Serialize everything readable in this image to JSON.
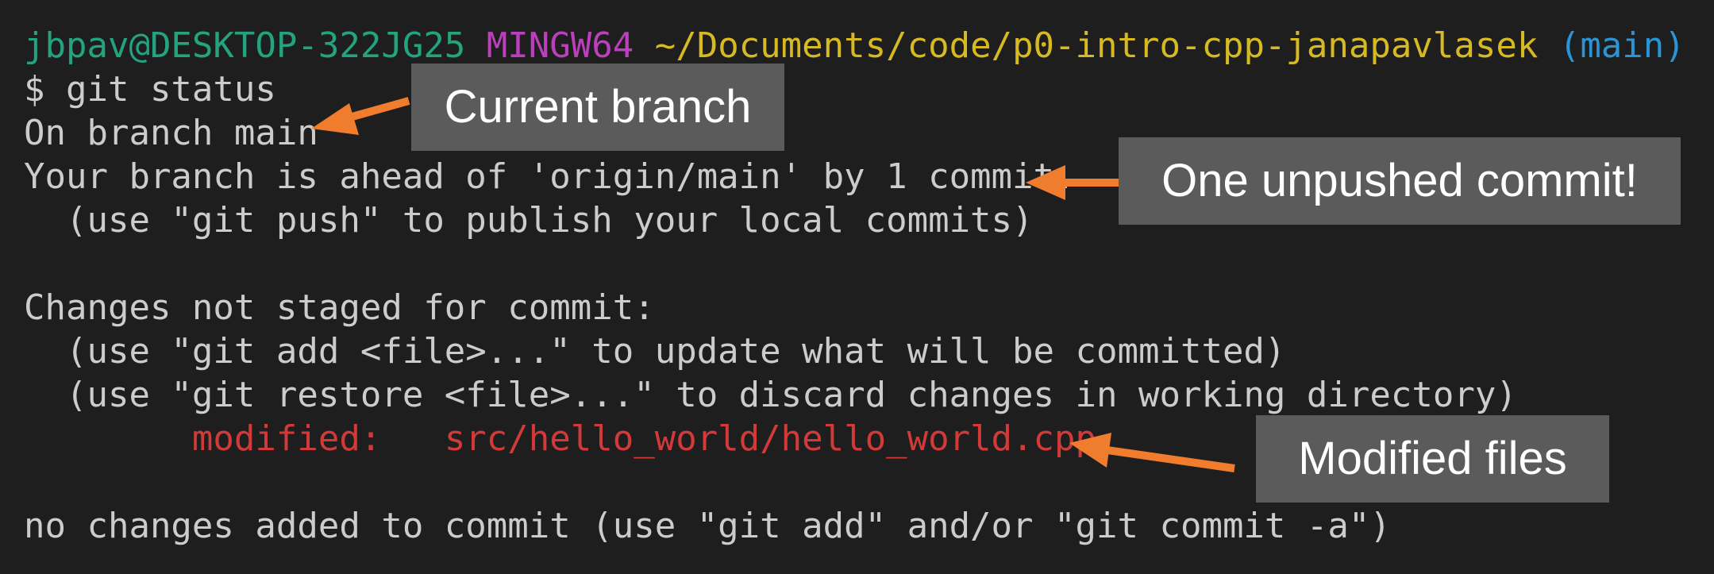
{
  "prompt": {
    "user_host": "jbpav@DESKTOP-322JG25",
    "env": "MINGW64",
    "path": "~/Documents/code/p0-intro-cpp-janapavlasek",
    "branch": "(main)"
  },
  "command": "$ git status",
  "output": {
    "line1": "On branch main",
    "line2": "Your branch is ahead of 'origin/main' by 1 commit.",
    "line3": "  (use \"git push\" to publish your local commits)",
    "line4": "Changes not staged for commit:",
    "line5": "  (use \"git add <file>...\" to update what will be committed)",
    "line6": "  (use \"git restore <file>...\" to discard changes in working directory)",
    "modified_label": "        modified:   ",
    "modified_file": "src/hello_world/hello_world.cpp",
    "line8": "no changes added to commit (use \"git add\" and/or \"git commit -a\")"
  },
  "callouts": {
    "current_branch": "Current branch",
    "unpushed": "One unpushed commit!",
    "modified_files": "Modified files"
  },
  "colors": {
    "background": "#1e1e1e",
    "text": "#cccccc",
    "user": "#23a47f",
    "env": "#bc3fbc",
    "path": "#d7ba22",
    "branch": "#2995d6",
    "modified": "#d23a3a",
    "callout_bg": "#5b5b5b",
    "arrow": "#ef7d2d"
  }
}
